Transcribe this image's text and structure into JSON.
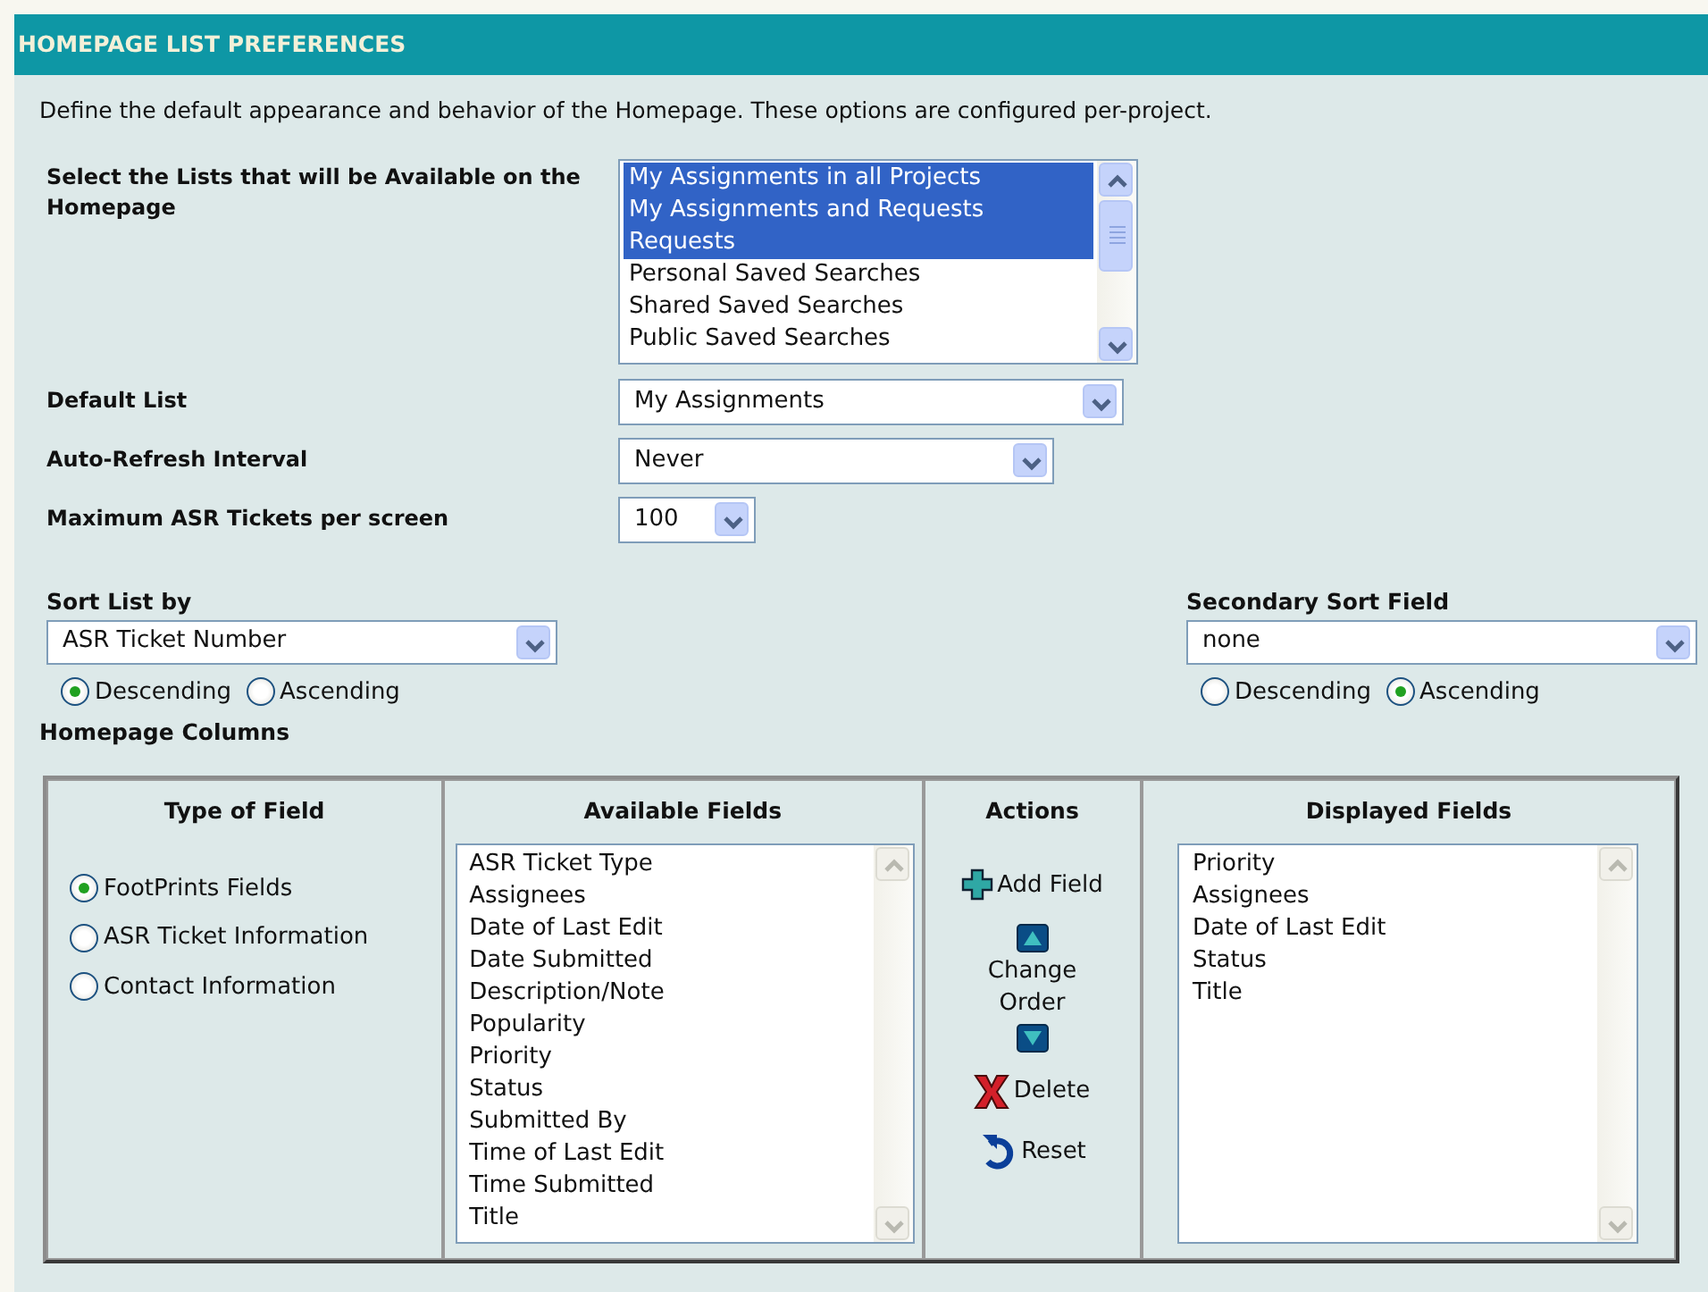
{
  "header": {
    "title": "HOMEPAGE LIST PREFERENCES"
  },
  "description": "Define the default appearance and behavior of the Homepage. These options are configured per-project.",
  "available_lists": {
    "label": "Select the Lists that will be Available on the Homepage",
    "options": [
      {
        "label": "My Assignments in all Projects",
        "selected": true
      },
      {
        "label": "My Assignments and Requests",
        "selected": true
      },
      {
        "label": "Requests",
        "selected": true
      },
      {
        "label": "Personal Saved Searches",
        "selected": false
      },
      {
        "label": "Shared Saved Searches",
        "selected": false
      },
      {
        "label": "Public Saved Searches",
        "selected": false
      }
    ]
  },
  "settings": [
    {
      "label": "Default List",
      "value": "My Assignments"
    },
    {
      "label": "Auto-Refresh Interval",
      "value": "Never"
    },
    {
      "label": "Maximum ASR Tickets per screen",
      "value": "100"
    }
  ],
  "sort": [
    {
      "label": "Sort List by",
      "value": "ASR Ticket Number",
      "order": [
        {
          "label": "Descending",
          "selected": true
        },
        {
          "label": "Ascending",
          "selected": false
        }
      ]
    },
    {
      "label": "Secondary Sort Field",
      "value": "none",
      "order": [
        {
          "label": "Descending",
          "selected": false
        },
        {
          "label": "Ascending",
          "selected": true
        }
      ]
    }
  ],
  "columns": {
    "title": "Homepage Columns",
    "type_of_field": {
      "heading": "Type of Field",
      "options": [
        {
          "label": "FootPrints Fields",
          "selected": true
        },
        {
          "label": "ASR Ticket Information",
          "selected": false
        },
        {
          "label": "Contact Information",
          "selected": false
        }
      ]
    },
    "available_fields": {
      "heading": "Available Fields",
      "items": [
        "ASR Ticket Type",
        "Assignees",
        "Date of Last Edit",
        "Date Submitted",
        "Description/Note",
        "Popularity",
        "Priority",
        "Status",
        "Submitted By",
        "Time of Last Edit",
        "Time Submitted",
        "Title"
      ]
    },
    "actions": {
      "heading": "Actions",
      "items": [
        {
          "kind": "add",
          "label": "Add Field"
        },
        {
          "kind": "move_up"
        },
        {
          "kind": "text",
          "label": "Change Order"
        },
        {
          "kind": "move_down"
        },
        {
          "kind": "delete",
          "label": "Delete"
        },
        {
          "kind": "reset",
          "label": "Reset"
        }
      ]
    },
    "displayed_fields": {
      "heading": "Displayed Fields",
      "items": [
        "Priority",
        "Assignees",
        "Date of Last Edit",
        "Status",
        "Title"
      ]
    }
  }
}
